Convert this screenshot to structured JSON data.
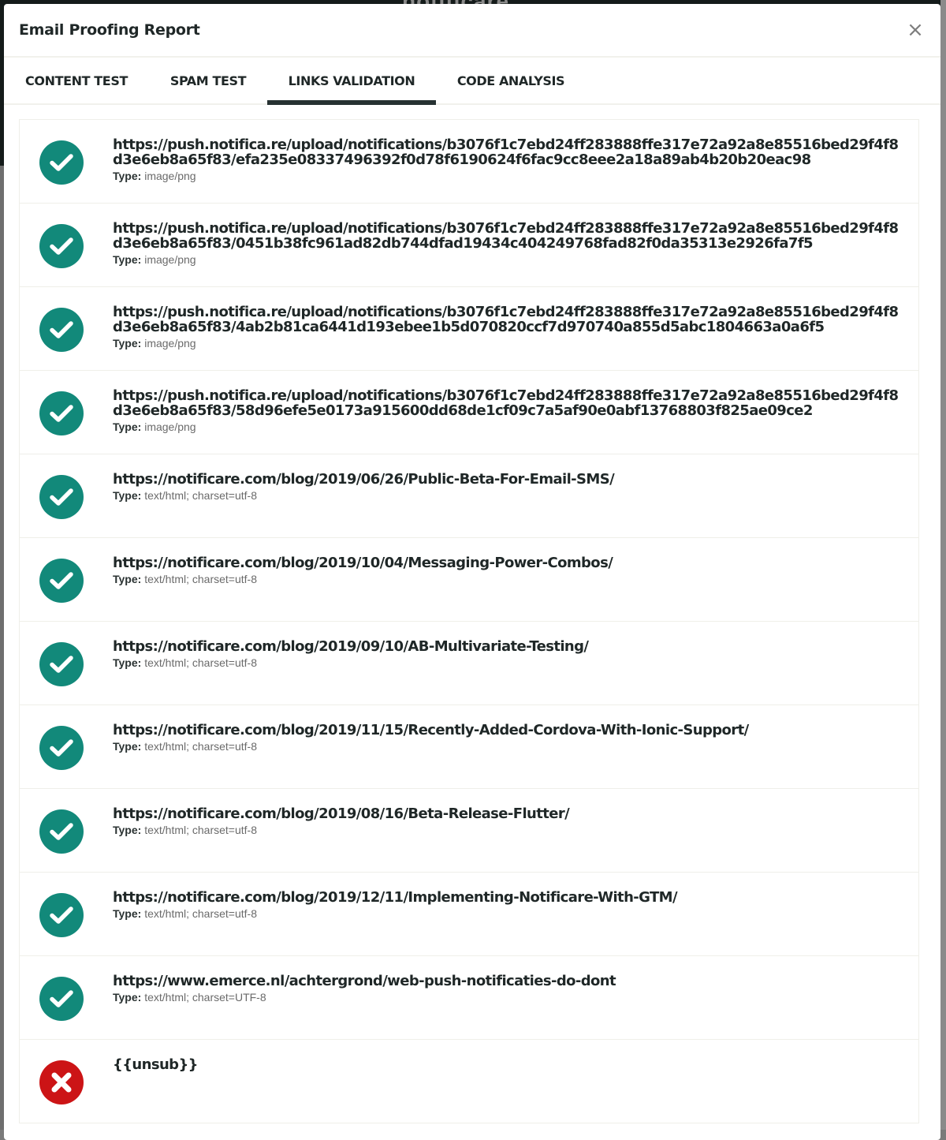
{
  "background": {
    "logo_text": "notificare"
  },
  "modal": {
    "title": "Email Proofing Report",
    "close_icon": "close-icon"
  },
  "tabs": [
    {
      "label": "CONTENT TEST",
      "active": false
    },
    {
      "label": "SPAM TEST",
      "active": false
    },
    {
      "label": "LINKS VALIDATION",
      "active": true
    },
    {
      "label": "CODE ANALYSIS",
      "active": false
    }
  ],
  "colors": {
    "ok": "#12897a",
    "fail": "#cc1416",
    "active_tab_underline": "#263232"
  },
  "type_label": "Type:",
  "links": [
    {
      "status": "valid",
      "icon": "check-circle-icon",
      "url": "https://push.notifica.re/upload/notifications/b3076f1c7ebd24ff283888ffe317e72a92a8e85516bed29f4f8d3e6eb8a65f83/efa235e08337496392f0d78f6190624f6fac9cc8eee2a18a89ab4b20b20eac98",
      "type": "image/png"
    },
    {
      "status": "valid",
      "icon": "check-circle-icon",
      "url": "https://push.notifica.re/upload/notifications/b3076f1c7ebd24ff283888ffe317e72a92a8e85516bed29f4f8d3e6eb8a65f83/0451b38fc961ad82db744dfad19434c404249768fad82f0da35313e2926fa7f5",
      "type": "image/png"
    },
    {
      "status": "valid",
      "icon": "check-circle-icon",
      "url": "https://push.notifica.re/upload/notifications/b3076f1c7ebd24ff283888ffe317e72a92a8e85516bed29f4f8d3e6eb8a65f83/4ab2b81ca6441d193ebee1b5d070820ccf7d970740a855d5abc1804663a0a6f5",
      "type": "image/png"
    },
    {
      "status": "valid",
      "icon": "check-circle-icon",
      "url": "https://push.notifica.re/upload/notifications/b3076f1c7ebd24ff283888ffe317e72a92a8e85516bed29f4f8d3e6eb8a65f83/58d96efe5e0173a915600dd68de1cf09c7a5af90e0abf13768803f825ae09ce2",
      "type": "image/png"
    },
    {
      "status": "valid",
      "icon": "check-circle-icon",
      "url": "https://notificare.com/blog/2019/06/26/Public-Beta-For-Email-SMS/",
      "type": "text/html; charset=utf-8"
    },
    {
      "status": "valid",
      "icon": "check-circle-icon",
      "url": "https://notificare.com/blog/2019/10/04/Messaging-Power-Combos/",
      "type": "text/html; charset=utf-8"
    },
    {
      "status": "valid",
      "icon": "check-circle-icon",
      "url": "https://notificare.com/blog/2019/09/10/AB-Multivariate-Testing/",
      "type": "text/html; charset=utf-8"
    },
    {
      "status": "valid",
      "icon": "check-circle-icon",
      "url": "https://notificare.com/blog/2019/11/15/Recently-Added-Cordova-With-Ionic-Support/",
      "type": "text/html; charset=utf-8"
    },
    {
      "status": "valid",
      "icon": "check-circle-icon",
      "url": "https://notificare.com/blog/2019/08/16/Beta-Release-Flutter/",
      "type": "text/html; charset=utf-8"
    },
    {
      "status": "valid",
      "icon": "check-circle-icon",
      "url": "https://notificare.com/blog/2019/12/11/Implementing-Notificare-With-GTM/",
      "type": "text/html; charset=utf-8"
    },
    {
      "status": "valid",
      "icon": "check-circle-icon",
      "url": "https://www.emerce.nl/achtergrond/web-push-notificaties-do-dont",
      "type": "text/html; charset=UTF-8"
    },
    {
      "status": "invalid",
      "icon": "x-circle-icon",
      "url": "{{unsub}}",
      "type": null
    }
  ]
}
